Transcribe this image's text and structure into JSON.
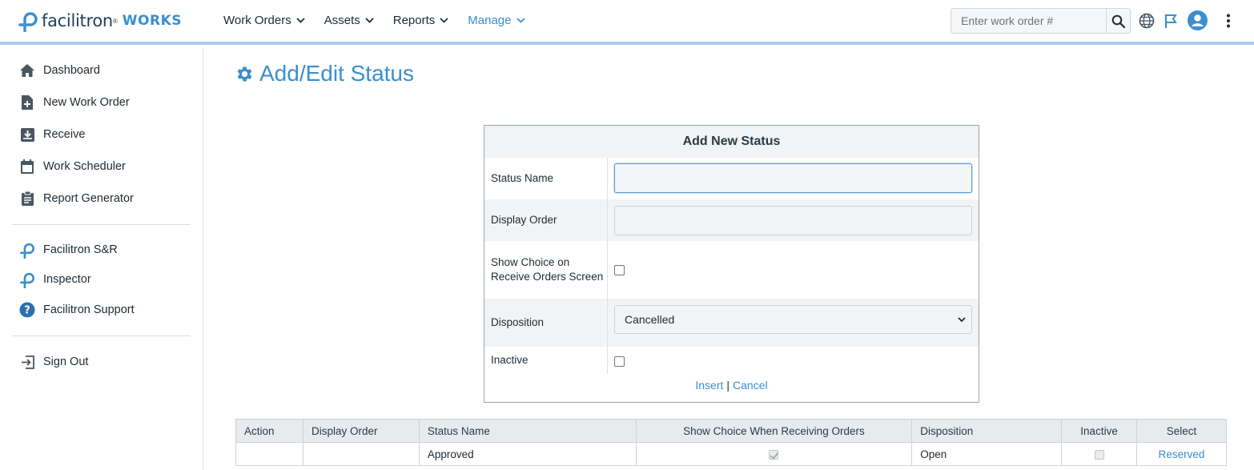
{
  "header": {
    "logo_name": "facilitron",
    "logo_reg": "®",
    "logo_product": "WORKS",
    "nav": [
      {
        "label": "Work Orders",
        "active": false
      },
      {
        "label": "Assets",
        "active": false
      },
      {
        "label": "Reports",
        "active": false
      },
      {
        "label": "Manage",
        "active": true
      }
    ],
    "search_placeholder": "Enter work order #",
    "search_value": ""
  },
  "sidebar": {
    "items": [
      {
        "label": "Dashboard",
        "icon": "home-icon"
      },
      {
        "label": "New Work Order",
        "icon": "file-plus-icon"
      },
      {
        "label": "Receive",
        "icon": "inbox-download-icon"
      },
      {
        "label": "Work Scheduler",
        "icon": "calendar-icon"
      },
      {
        "label": "Report Generator",
        "icon": "clipboard-icon"
      }
    ],
    "apps": [
      {
        "label": "Facilitron S&R",
        "icon": "facilitron-logo-icon"
      },
      {
        "label": "Inspector",
        "icon": "facilitron-logo-icon"
      },
      {
        "label": "Facilitron Support",
        "icon": "help-circle-icon"
      }
    ],
    "sign_out": "Sign Out"
  },
  "page": {
    "title": "Add/Edit Status"
  },
  "form": {
    "title": "Add New Status",
    "status_name_label": "Status Name",
    "status_name_value": "",
    "display_order_label": "Display Order",
    "display_order_value": "",
    "show_choice_label": "Show Choice on Receive Orders Screen",
    "show_choice_checked": false,
    "disposition_label": "Disposition",
    "disposition_value": "Cancelled",
    "inactive_label": "Inactive",
    "inactive_checked": false,
    "insert_label": "Insert",
    "separator": "|",
    "cancel_label": "Cancel"
  },
  "table": {
    "columns": [
      "Action",
      "Display Order",
      "Status Name",
      "Show Choice When Receiving Orders",
      "Disposition",
      "Inactive",
      "Select"
    ],
    "rows": [
      {
        "action": "",
        "display_order": "",
        "status_name": "Approved",
        "show_choice": true,
        "disposition": "Open",
        "inactive": false,
        "select": "Reserved"
      }
    ]
  },
  "colors": {
    "accent": "#3a8fd0",
    "topbar_border": "#a9cdea",
    "header_bg": "#e8ebee"
  }
}
